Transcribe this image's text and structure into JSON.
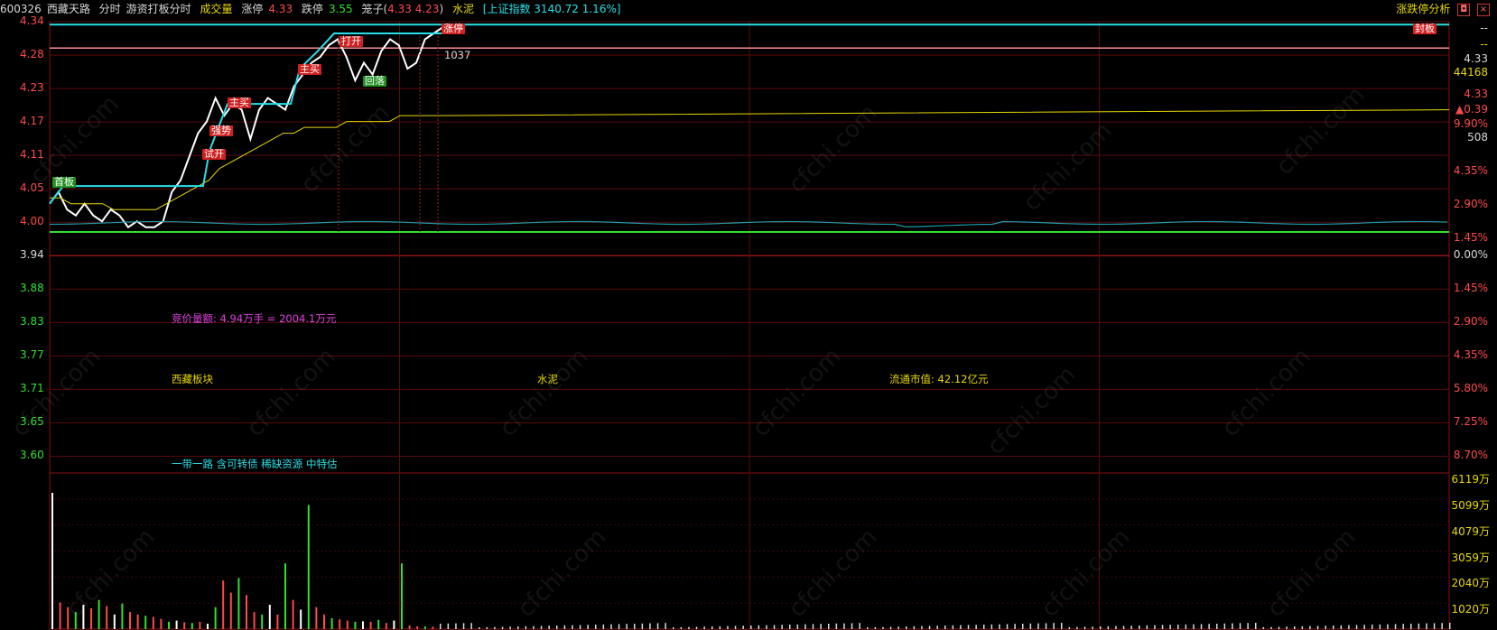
{
  "header": {
    "code": "600326",
    "name": "西藏天路",
    "view": "分时",
    "indicator": "游资打板分时",
    "volume_label": "成交量",
    "limit_up_label": "涨停",
    "limit_up_value": "4.33",
    "limit_down_label": "跌停",
    "limit_down_value": "3.55",
    "cage_label": "笼子(",
    "cage_values": "4.33 4.23",
    "cage_close": ")",
    "sector": "水泥",
    "index_text": "[上证指数 3140.72 1.16%]",
    "analysis_button": "涨跌停分析"
  },
  "price_axis": {
    "ticks": [
      "4.34",
      "4.28",
      "4.23",
      "4.17",
      "4.11",
      "4.05",
      "4.00",
      "3.94",
      "3.88",
      "3.83",
      "3.77",
      "3.71",
      "3.65",
      "3.60"
    ],
    "colors": {
      "up": "#ff4a4a",
      "mid": "#d8d8d8",
      "down": "#30e030"
    }
  },
  "pct_axis": {
    "side_values": [
      "--",
      "--",
      "4.33",
      "44168",
      "4.33",
      "▲0.39",
      "9.90%",
      "508"
    ],
    "ticks": [
      "4.35%",
      "2.90%",
      "1.45%",
      "0.00%",
      "1.45%",
      "2.90%",
      "4.35%",
      "5.80%",
      "7.25%",
      "8.70%"
    ]
  },
  "volume_axis": {
    "ticks": [
      "6119万",
      "5099万",
      "4079万",
      "3059万",
      "2040万",
      "1020万"
    ]
  },
  "annotations": {
    "auction": "竞价量额: 4.94万手 = 2004.1万元",
    "region": "西藏板块",
    "industry": "水泥",
    "float_cap": "流通市值: 42.12亿元",
    "concepts": "一带一路 含可转债 稀缺资源 中特估",
    "seal_label": "封板",
    "vol_count": "1037"
  },
  "tags": {
    "t1": "首板",
    "t2": "试开",
    "t3": "强势",
    "t4": "主买",
    "t5": "主买",
    "t6": "打开",
    "t7": "回落",
    "t8": "涨停",
    "t9": "封板"
  },
  "watermark": "cfchi.com",
  "chart_data": {
    "type": "line",
    "title": "",
    "series": [
      {
        "values": [
          4.03,
          4.05,
          4.02,
          4.01,
          4.03,
          4.01,
          4.0,
          4.02,
          4.01,
          3.99,
          4.0,
          3.99,
          3.99,
          4.0,
          4.05,
          4.07,
          4.11,
          4.15,
          4.17,
          4.21,
          4.18,
          4.2,
          4.19,
          4.14,
          4.19,
          4.21,
          4.2,
          4.19,
          4.23,
          4.25,
          4.27,
          4.28,
          4.3,
          4.31,
          4.28,
          4.24,
          4.27,
          4.25,
          4.29,
          4.31,
          4.3,
          4.26,
          4.27,
          4.31,
          4.32,
          4.33
        ]
      },
      {
        "values": [
          4.04,
          4.04,
          4.03,
          4.03,
          4.03,
          4.03,
          4.02,
          4.02,
          4.02,
          4.02,
          4.02,
          4.03,
          4.04,
          4.05,
          4.06,
          4.07,
          4.09,
          4.1,
          4.11,
          4.12,
          4.13,
          4.14,
          4.15,
          4.15,
          4.16,
          4.16,
          4.16,
          4.16,
          4.17,
          4.17,
          4.17,
          4.17,
          4.17,
          4.18,
          4.18,
          4.18,
          4.18,
          4.18
        ]
      }
    ],
    "ylim": [
      3.55,
      4.35
    ],
    "volume": [
      5600,
      1100,
      900,
      700,
      1000,
      850,
      1200,
      950,
      600,
      1050,
      700,
      600,
      550,
      500,
      420,
      300,
      350,
      280,
      250,
      300,
      220,
      900,
      2000,
      1500,
      2100,
      1400,
      700,
      600,
      1000,
      600,
      2700,
      1200,
      800,
      5100,
      900,
      600,
      450,
      400,
      350,
      300,
      320,
      300,
      380,
      250,
      350,
      2700,
      150,
      120,
      110,
      100
    ]
  }
}
